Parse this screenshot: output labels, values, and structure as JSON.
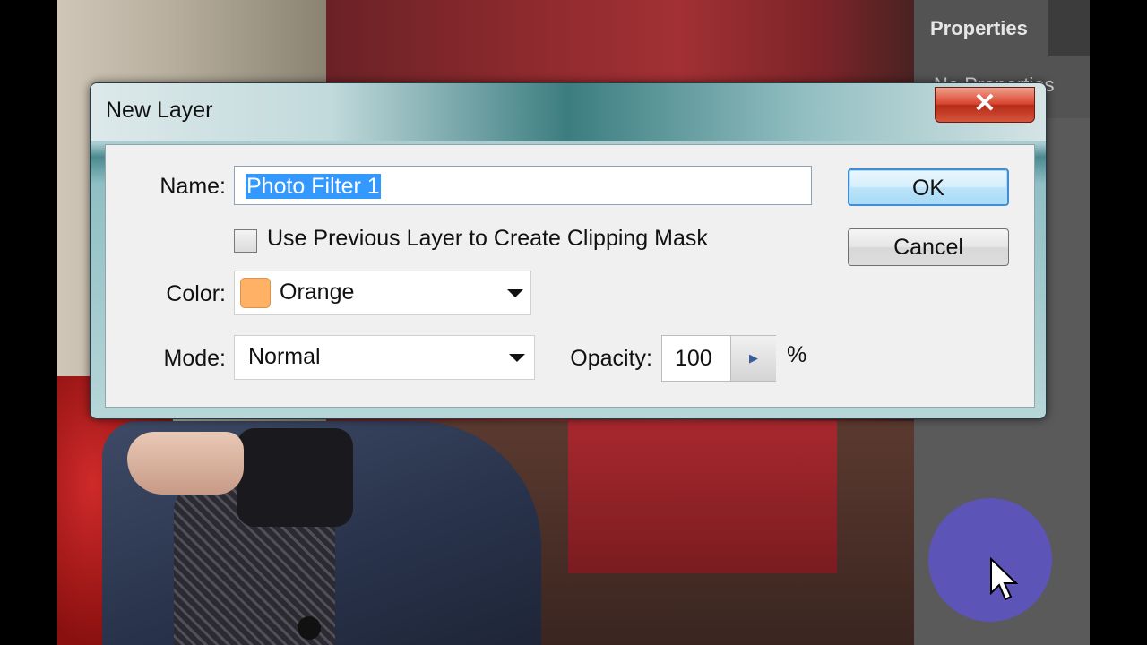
{
  "dialog": {
    "title": "New Layer",
    "close_glyph": "✕",
    "name_label": "Name:",
    "name_value": "Photo Filter 1",
    "clipping_label": "Use Previous Layer to Create Clipping Mask",
    "clipping_checked": false,
    "color_label": "Color:",
    "color_value": "Orange",
    "color_swatch": "#ffb266",
    "mode_label": "Mode:",
    "mode_value": "Normal",
    "opacity_label": "Opacity:",
    "opacity_value": "100",
    "opacity_unit": "%",
    "ok_label": "OK",
    "cancel_label": "Cancel"
  },
  "panel": {
    "tab_label": "Properties",
    "subtitle": "No Properties"
  },
  "icons": {
    "close": "close-icon",
    "dropdown": "chevron-down-icon",
    "stepper": "arrow-right-icon",
    "cursor": "mouse-pointer-icon"
  },
  "colors": {
    "accent": "#3399ff",
    "close_red": "#d8432c",
    "cursor_halo": "#5d54b8"
  }
}
